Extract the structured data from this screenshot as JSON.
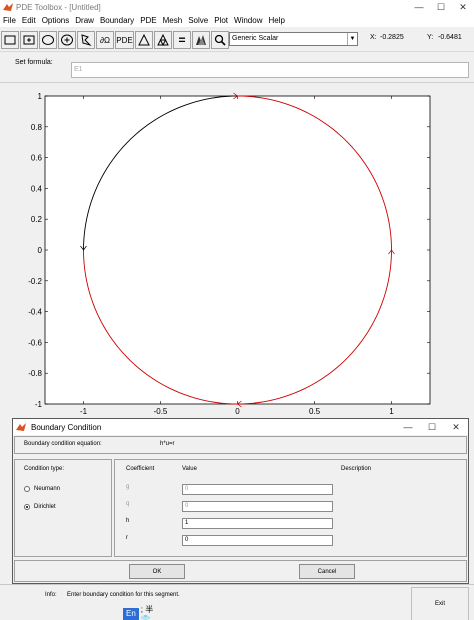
{
  "window": {
    "title": "PDE Toolbox - [Untitled]",
    "controls": [
      "—",
      "☐",
      "✕"
    ]
  },
  "menu": [
    "File",
    "Edit",
    "Options",
    "Draw",
    "Boundary",
    "PDE",
    "Mesh",
    "Solve",
    "Plot",
    "Window",
    "Help"
  ],
  "toolbar": {
    "buttons": [
      "rectangle-icon",
      "rectangle-center-icon",
      "ellipse-icon",
      "ellipse-center-icon",
      "polygon-icon",
      "boundary-mode-icon",
      "pde-spec-label",
      "mesh-init-icon",
      "mesh-refine-icon",
      "solve-icon",
      "plot-icon",
      "zoom-icon"
    ],
    "boundary_label": "∂Ω",
    "pde_label": "PDE",
    "solve_label": "=",
    "app_select": "Generic Scalar",
    "x_label": "X:",
    "x_value": "-0.2825",
    "y_label": "Y:",
    "y_value": "-0.6481"
  },
  "formula": {
    "label": "Set formula:",
    "value": "E1"
  },
  "chart_data": {
    "type": "line",
    "title": "",
    "xlabel": "",
    "ylabel": "",
    "xlim": [
      -1.25,
      1.25
    ],
    "ylim": [
      -1,
      1
    ],
    "x_ticks": [
      "-1",
      "-0.5",
      "0",
      "0.5",
      "1"
    ],
    "y_ticks": [
      "1",
      "0.8",
      "0.6",
      "0.4",
      "0.2",
      "0",
      "-0.2",
      "-0.4",
      "-0.6",
      "-0.8",
      "-1"
    ],
    "grid": false,
    "series": [
      {
        "color": "#000000",
        "arc_deg": [
          90,
          180
        ]
      },
      {
        "color": "#cc0000",
        "arc_deg": [
          180,
          450
        ]
      }
    ]
  },
  "dialog": {
    "title": "Boundary Condition",
    "equation_label": "Boundary condition equation:",
    "equation": "h*u=r",
    "condition_type_label": "Condition type:",
    "options": [
      {
        "label": "Neumann",
        "selected": false
      },
      {
        "label": "Dirichlet",
        "selected": true
      }
    ],
    "headers": {
      "coefficient": "Coefficient",
      "value": "Value",
      "description": "Description"
    },
    "rows": [
      {
        "name": "g",
        "value": "0",
        "enabled": false
      },
      {
        "name": "q",
        "value": "0",
        "enabled": false
      },
      {
        "name": "h",
        "value": "1",
        "enabled": true
      },
      {
        "name": "r",
        "value": "0",
        "enabled": true
      }
    ],
    "ok_label": "OK",
    "cancel_label": "Cancel"
  },
  "status": {
    "info_label": "Info:",
    "message": "Enter boundary condition for this segment.",
    "exit_label": "Exit"
  },
  "ime": {
    "lang": "En",
    "rest": "; 半 👕"
  }
}
